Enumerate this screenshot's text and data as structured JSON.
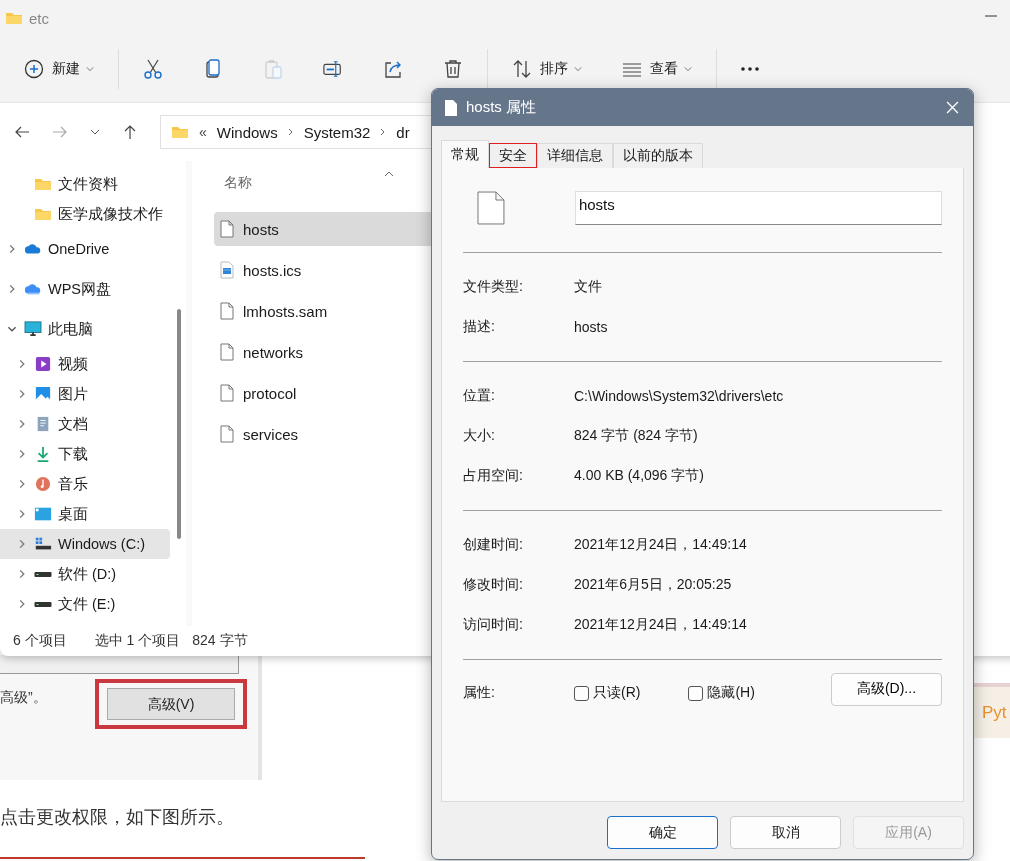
{
  "explorer": {
    "title": "etc",
    "toolbar": [
      [
        {
          "kind": "new",
          "label": "新建",
          "dropdown": true,
          "disabled": false
        }
      ],
      [
        {
          "kind": "cut",
          "disabled": false,
          "dropdown": false
        },
        {
          "kind": "copy",
          "disabled": false,
          "dropdown": false
        },
        {
          "kind": "paste",
          "disabled": true,
          "dropdown": false
        },
        {
          "kind": "rename",
          "disabled": false,
          "dropdown": false
        },
        {
          "kind": "share",
          "disabled": false,
          "dropdown": false
        },
        {
          "kind": "delete",
          "disabled": false,
          "dropdown": false
        }
      ],
      [
        {
          "kind": "sort",
          "label": "排序",
          "dropdown": true,
          "disabled": false
        },
        {
          "kind": "view",
          "label": "查看",
          "dropdown": true,
          "disabled": false
        }
      ],
      [
        {
          "kind": "more",
          "disabled": false,
          "dropdown": false
        }
      ]
    ],
    "address": {
      "overflow": "«",
      "path": [
        "Windows",
        "System32",
        "dr"
      ]
    },
    "nav": {
      "partial_children": [
        {
          "label": "文件资料",
          "kind": "folder",
          "selected": false
        },
        {
          "label": "医学成像技术作",
          "kind": "folder",
          "selected": false
        }
      ],
      "items": [
        {
          "label": "OneDrive",
          "kind": "onedrive",
          "expanded": false,
          "selected": false
        },
        {
          "label": "WPS网盘",
          "kind": "cloud",
          "expanded": false,
          "selected": false
        },
        {
          "label": "此电脑",
          "kind": "monitor",
          "expanded": true,
          "selected": false,
          "children": [
            {
              "label": "视频",
              "kind": "video",
              "expanded": false,
              "selected": false
            },
            {
              "label": "图片",
              "kind": "image",
              "expanded": false,
              "selected": false
            },
            {
              "label": "文档",
              "kind": "document",
              "expanded": false,
              "selected": false
            },
            {
              "label": "下载",
              "kind": "download",
              "expanded": false,
              "selected": false
            },
            {
              "label": "音乐",
              "kind": "music",
              "expanded": false,
              "selected": false
            },
            {
              "label": "桌面",
              "kind": "desktop",
              "expanded": false,
              "selected": false
            },
            {
              "label": "Windows (C:)",
              "kind": "system-drive",
              "expanded": false,
              "selected": true
            },
            {
              "label": "软件 (D:)",
              "kind": "drive",
              "expanded": false,
              "selected": false
            },
            {
              "label": "文件 (E:)",
              "kind": "drive",
              "expanded": false,
              "selected": false
            }
          ]
        }
      ]
    },
    "column": "名称",
    "files": [
      {
        "name": "hosts",
        "kind": "file",
        "selected": true
      },
      {
        "name": "hosts.ics",
        "kind": "calendar",
        "selected": false
      },
      {
        "name": "lmhosts.sam",
        "kind": "file",
        "selected": false
      },
      {
        "name": "networks",
        "kind": "file",
        "selected": false
      },
      {
        "name": "protocol",
        "kind": "file",
        "selected": false
      },
      {
        "name": "services",
        "kind": "file",
        "selected": false
      }
    ],
    "status_bar": [
      "6 个项目",
      "选中 1 个项目",
      "824 字节"
    ]
  },
  "web_page": {
    "snippet_text": "高级”。",
    "snippet_button": "高级(V)",
    "paragraph": "点击更改权限，如下图所示。",
    "side_card": "Pyt"
  },
  "dialog": {
    "title": "hosts 属性",
    "tabs": [
      {
        "label": "常规",
        "selected": true,
        "highlighted": false
      },
      {
        "label": "安全",
        "selected": false,
        "highlighted": true
      },
      {
        "label": "详细信息",
        "selected": false,
        "highlighted": false
      },
      {
        "label": "以前的版本",
        "selected": false,
        "highlighted": false
      }
    ],
    "file_name": "hosts",
    "groups": [
      [
        {
          "label": "文件类型:",
          "value": "文件"
        },
        {
          "label": "描述:",
          "value": "hosts"
        }
      ],
      [
        {
          "label": "位置:",
          "value": "C:\\Windows\\System32\\drivers\\etc"
        },
        {
          "label": "大小:",
          "value": "824 字节 (824 字节)"
        },
        {
          "label": "占用空间:",
          "value": "4.00 KB (4,096 字节)"
        }
      ],
      [
        {
          "label": "创建时间:",
          "value": "2021年12月24日，14:49:14"
        },
        {
          "label": "修改时间:",
          "value": "2021年6月5日，20:05:25"
        },
        {
          "label": "访问时间:",
          "value": "2021年12月24日，14:49:14"
        }
      ]
    ],
    "attributes": {
      "label": "属性:",
      "checkboxes": [
        {
          "label": "只读(R)",
          "checked": false
        },
        {
          "label": "隐藏(H)",
          "checked": false
        }
      ],
      "button": "高级(D)..."
    },
    "buttons": [
      {
        "label": "确定",
        "default": true,
        "disabled": false
      },
      {
        "label": "取消",
        "default": false,
        "disabled": false
      },
      {
        "label": "应用(A)",
        "default": false,
        "disabled": true
      }
    ]
  }
}
